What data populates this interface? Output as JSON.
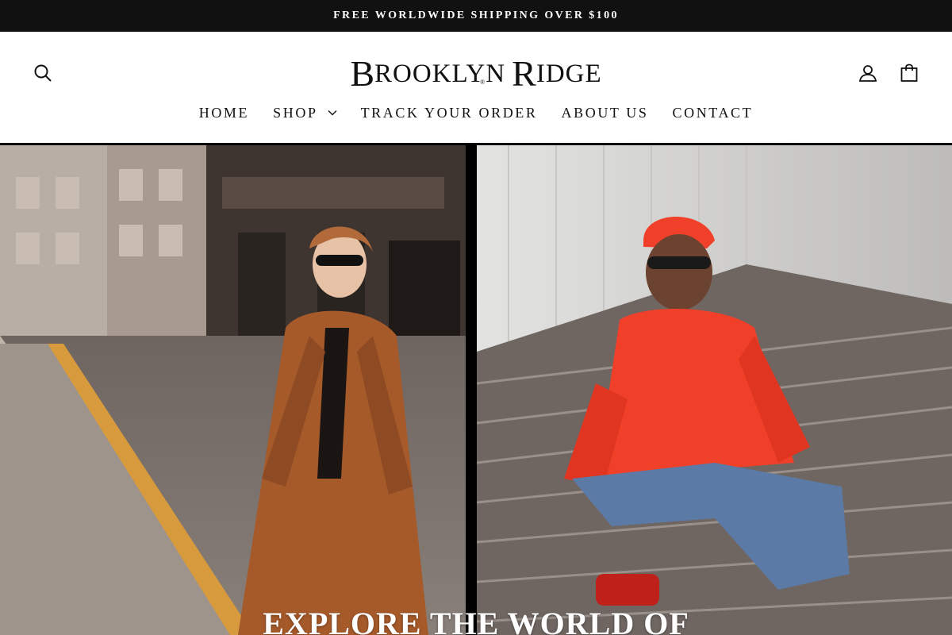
{
  "announcement": {
    "text": "FREE WORLDWIDE SHIPPING OVER $100"
  },
  "brand": {
    "logo_b": "B",
    "logo_rooklyn": "ROOKLYN",
    "logo_r": "R",
    "logo_idge": "IDGE",
    "logo_reg": "®"
  },
  "nav": {
    "items": [
      {
        "label": "HOME"
      },
      {
        "label": "SHOP"
      },
      {
        "label": "TRACK YOUR ORDER"
      },
      {
        "label": "ABOUT US"
      },
      {
        "label": "CONTACT"
      }
    ]
  },
  "icons": {
    "search": "search-icon",
    "account": "user-icon",
    "cart": "shopping-bag-icon",
    "shop_dropdown": "chevron-down-icon"
  },
  "hero": {
    "heading": "EXPLORE THE WORLD OF",
    "left_image": "woman-in-brown-coat-street-photo",
    "right_image": "man-in-orange-jacket-on-stairs-photo"
  },
  "colors": {
    "announcement_bg": "#111111",
    "text": "#111111",
    "jacket_orange": "#f0402a",
    "coat_brown": "#a65a2a"
  }
}
